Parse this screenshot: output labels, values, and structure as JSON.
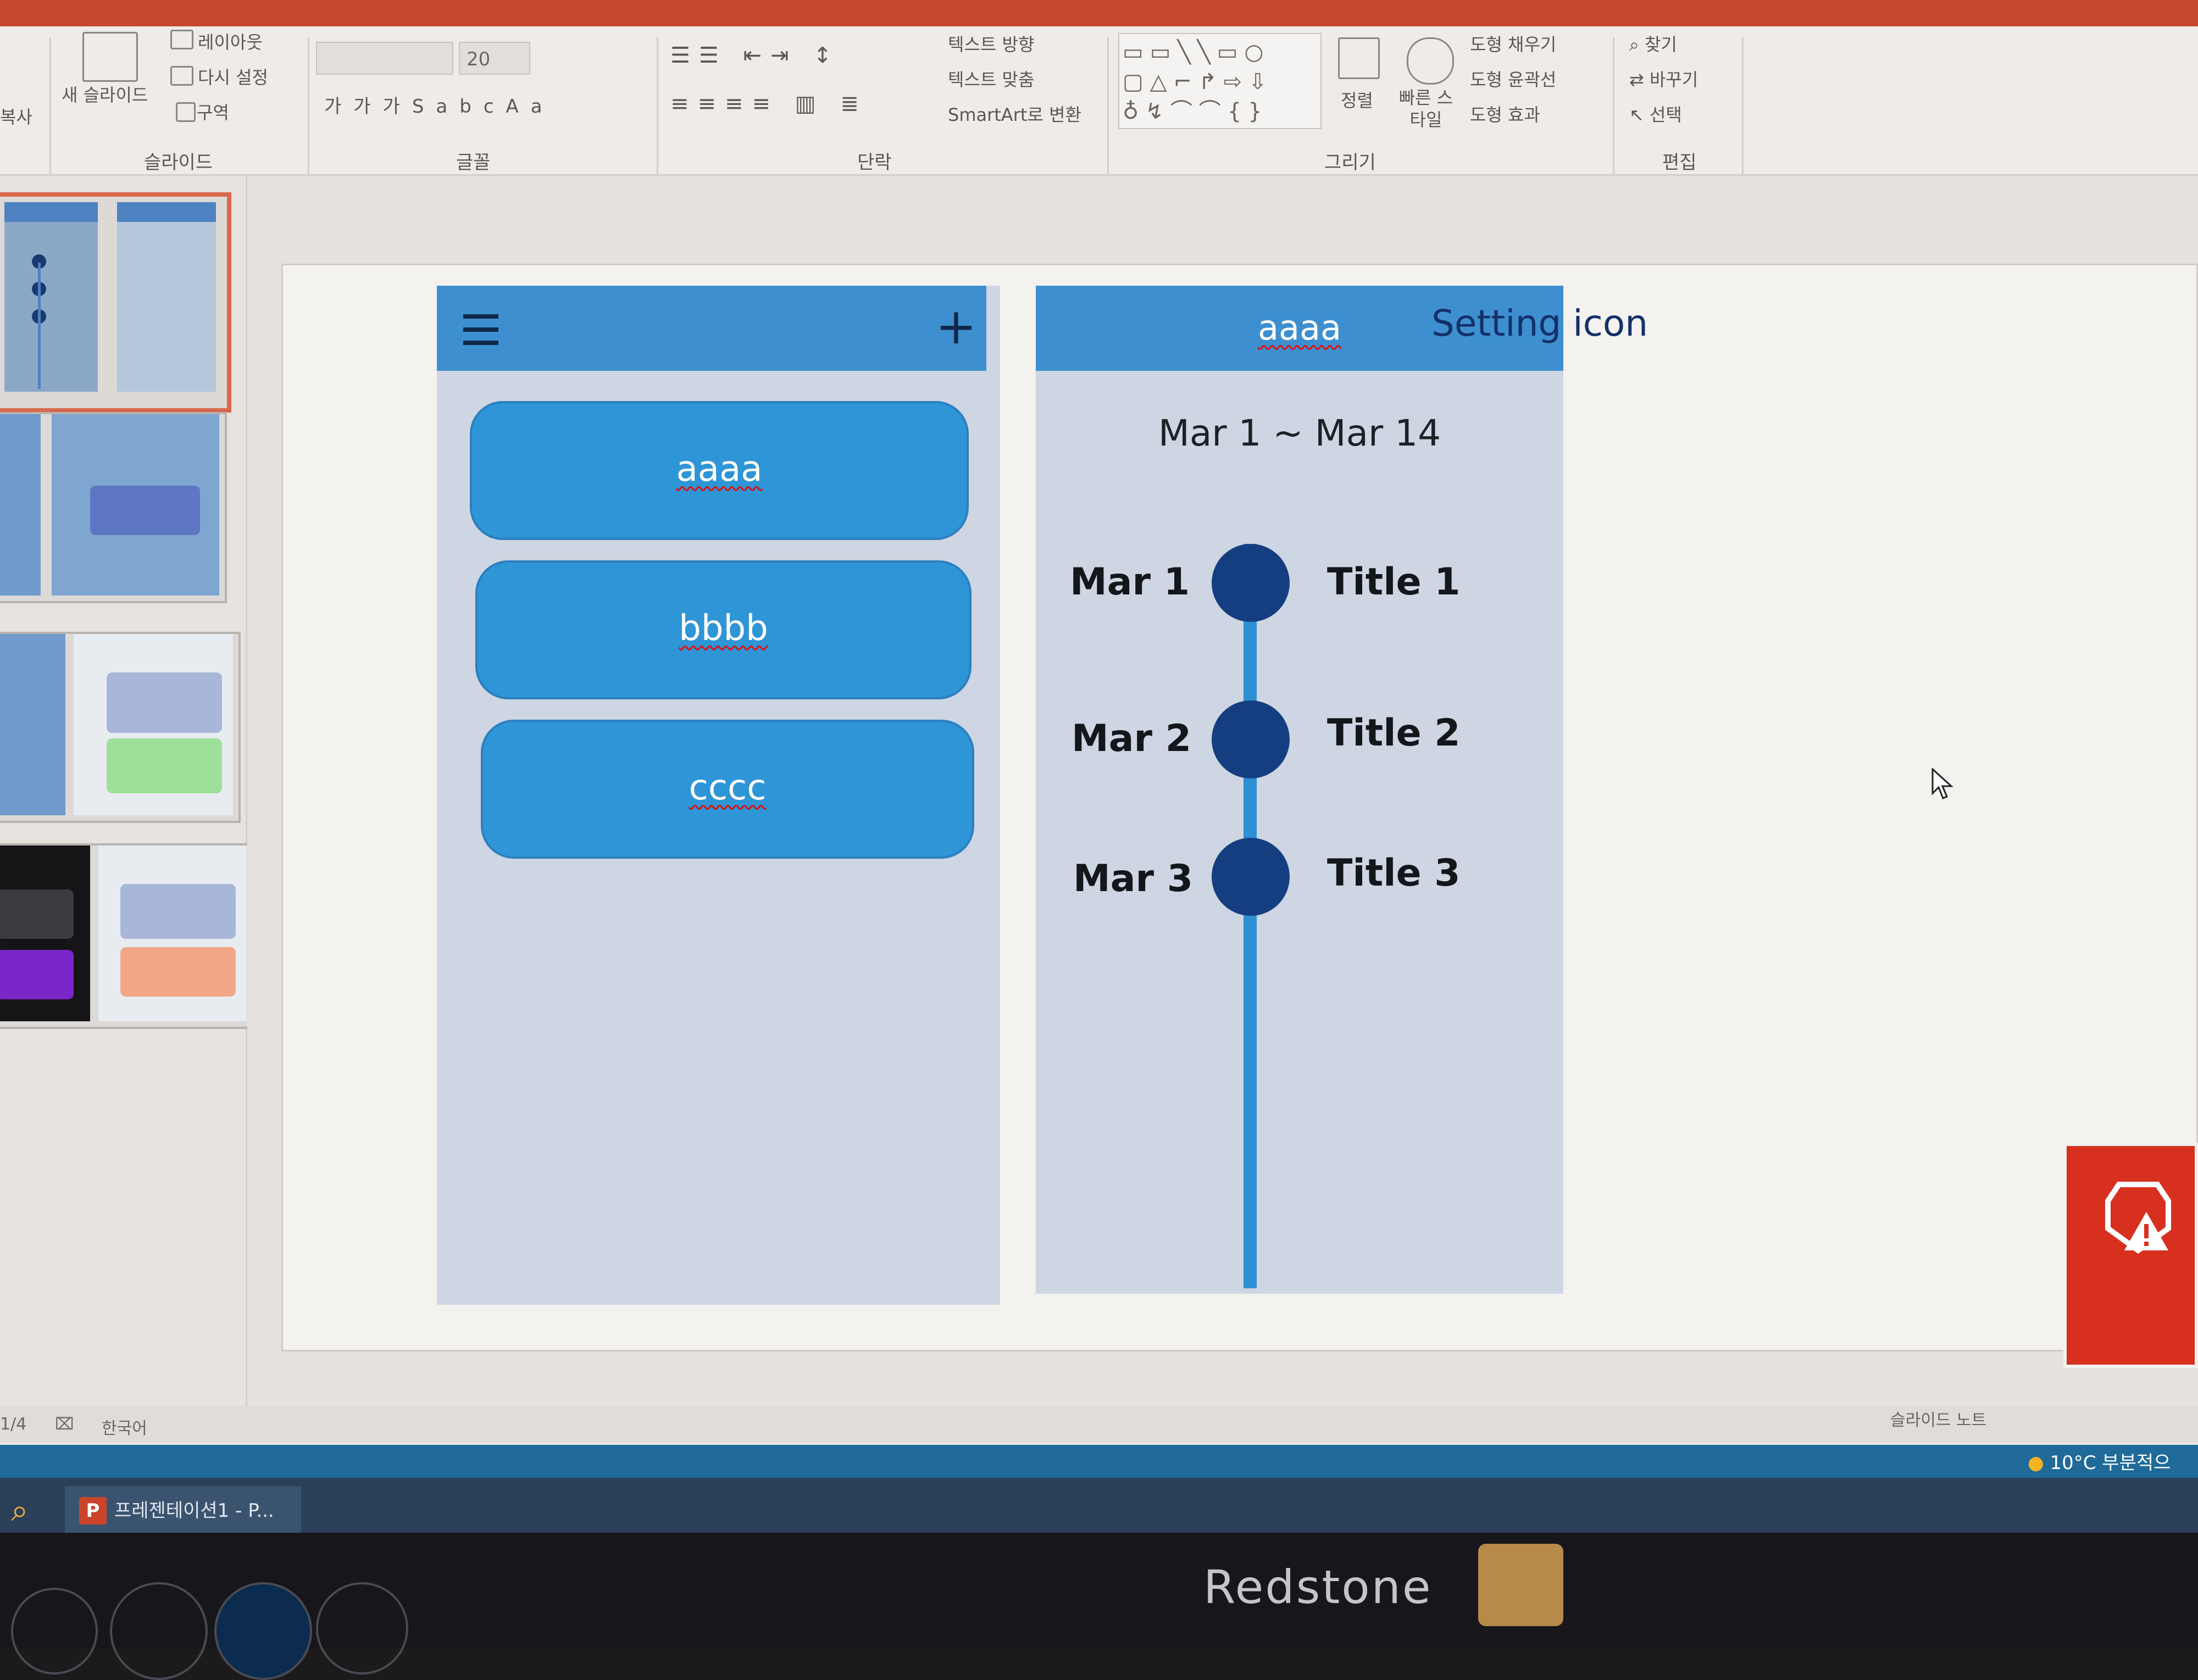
{
  "ribbon": {
    "slides_group": {
      "new_slide": "새 슬라이드",
      "layout": "레이아웃",
      "reset": "다시 설정",
      "section": "구역",
      "label": "슬라이드"
    },
    "font_group": {
      "font_size": "20",
      "label": "글꼴"
    },
    "paragraph_group": {
      "text_direction": "텍스트 방향",
      "align_text": "텍스트 맞춤",
      "smartart": "SmartArt로 변환",
      "label": "단락"
    },
    "drawing_group": {
      "arrange": "정렬",
      "quick_styles": "빠른 스타일",
      "shape_fill": "도형 채우기",
      "shape_outline": "도형 윤곽선",
      "shape_effects": "도형 효과",
      "label": "그리기"
    },
    "editing_group": {
      "find": "찾기",
      "replace": "바꾸기",
      "select": "선택",
      "label": "편집"
    },
    "left_partial": {
      "copy": "복사"
    }
  },
  "slide": {
    "left_panel": {
      "items": [
        {
          "label": "aaaa"
        },
        {
          "label": "bbbb"
        },
        {
          "label": "cccc"
        }
      ]
    },
    "right_panel": {
      "header_title": "aaaa",
      "setting_label": "Setting icon",
      "date_range": "Mar 1 ~ Mar 14",
      "timeline": [
        {
          "date": "Mar 1",
          "title": "Title 1"
        },
        {
          "date": "Mar 2",
          "title": "Title 2"
        },
        {
          "date": "Mar 3",
          "title": "Title 3"
        }
      ]
    }
  },
  "status": {
    "slide_counter": "1/4",
    "language": "한국어",
    "notes": "슬라이드 노트"
  },
  "taskbar": {
    "app_label": "프레젠테이션1 - P...",
    "weather": "10°C 부분적으"
  },
  "monitor": {
    "brand": "Redstone"
  },
  "colors": {
    "header_blue": "#3e8fcf",
    "button_blue": "#2e95d6",
    "timeline_dot": "#153e80",
    "panel_bg": "#cdd6e2",
    "selected_thumb_border": "#d8684c"
  }
}
